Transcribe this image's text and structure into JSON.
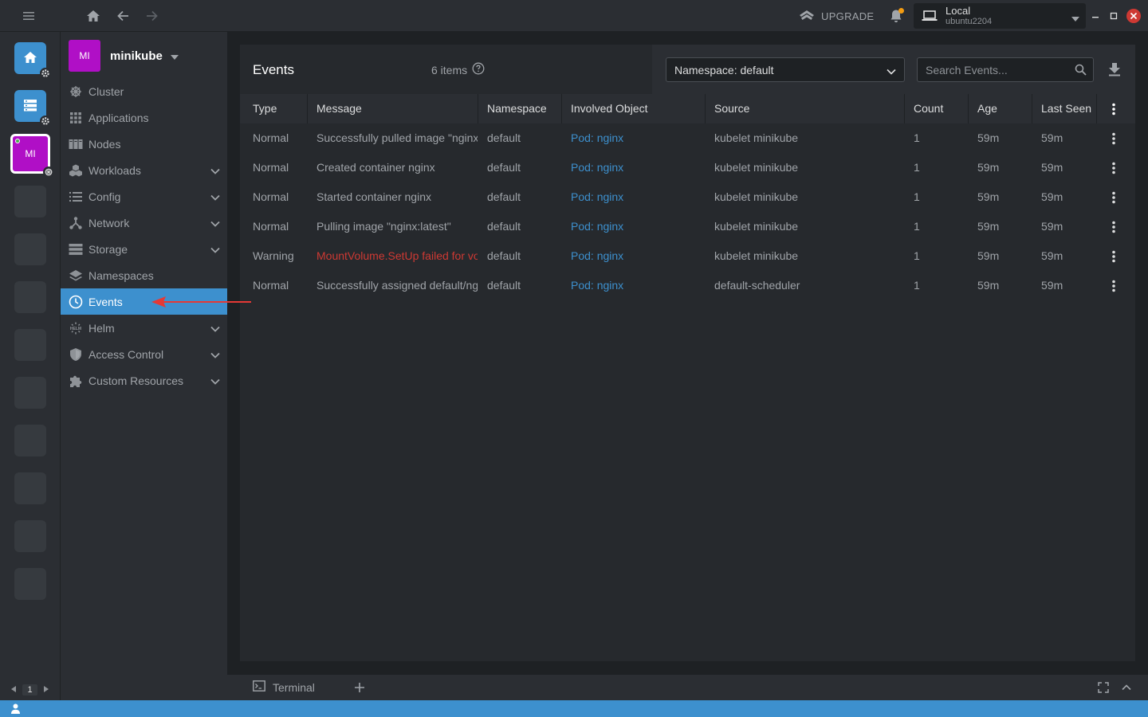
{
  "topbar": {
    "upgrade_label": "UPGRADE",
    "context_title": "Local",
    "context_subtitle": "ubuntu2204"
  },
  "hotbar": {
    "cluster_initials": "MI",
    "page_number": "1"
  },
  "cluster": {
    "initials": "MI",
    "name": "minikube"
  },
  "nav": {
    "items": [
      {
        "label": "Cluster",
        "icon": "helm-wheel-icon"
      },
      {
        "label": "Applications",
        "icon": "grid-icon"
      },
      {
        "label": "Nodes",
        "icon": "nodes-icon"
      },
      {
        "label": "Workloads",
        "icon": "workloads-icon"
      },
      {
        "label": "Config",
        "icon": "list-icon"
      },
      {
        "label": "Network",
        "icon": "network-icon"
      },
      {
        "label": "Storage",
        "icon": "storage-icon"
      },
      {
        "label": "Namespaces",
        "icon": "layers-icon"
      },
      {
        "label": "Events",
        "icon": "clock-icon"
      },
      {
        "label": "Helm",
        "icon": "helm-logo-icon"
      },
      {
        "label": "Access Control",
        "icon": "shield-icon"
      },
      {
        "label": "Custom Resources",
        "icon": "puzzle-icon"
      }
    ]
  },
  "events": {
    "title": "Events",
    "items_count": "6 items",
    "namespace_select": "Namespace: default",
    "search_placeholder": "Search Events..."
  },
  "table": {
    "columns": [
      "Type",
      "Message",
      "Namespace",
      "Involved Object",
      "Source",
      "Count",
      "Age",
      "Last Seen"
    ],
    "rows": [
      {
        "type": "Normal",
        "message": "Successfully pulled image \"nginx:latest\"",
        "namespace": "default",
        "object": "Pod: nginx",
        "source": "kubelet minikube",
        "count": "1",
        "age": "59m",
        "last_seen": "59m"
      },
      {
        "type": "Normal",
        "message": "Created container nginx",
        "namespace": "default",
        "object": "Pod: nginx",
        "source": "kubelet minikube",
        "count": "1",
        "age": "59m",
        "last_seen": "59m"
      },
      {
        "type": "Normal",
        "message": "Started container nginx",
        "namespace": "default",
        "object": "Pod: nginx",
        "source": "kubelet minikube",
        "count": "1",
        "age": "59m",
        "last_seen": "59m"
      },
      {
        "type": "Normal",
        "message": "Pulling image \"nginx:latest\"",
        "namespace": "default",
        "object": "Pod: nginx",
        "source": "kubelet minikube",
        "count": "1",
        "age": "59m",
        "last_seen": "59m"
      },
      {
        "type": "Warning",
        "message": "MountVolume.SetUp failed for volume",
        "namespace": "default",
        "object": "Pod: nginx",
        "source": "kubelet minikube",
        "count": "1",
        "age": "59m",
        "last_seen": "59m"
      },
      {
        "type": "Normal",
        "message": "Successfully assigned default/nginx to minikube",
        "namespace": "default",
        "object": "Pod: nginx",
        "source": "default-scheduler",
        "count": "1",
        "age": "59m",
        "last_seen": "59m"
      }
    ]
  },
  "dock": {
    "terminal_label": "Terminal"
  },
  "colors": {
    "accent": "#3d90ce",
    "warning": "#ce3933",
    "cluster": "#b00fc6",
    "notification": "#f39c12"
  }
}
